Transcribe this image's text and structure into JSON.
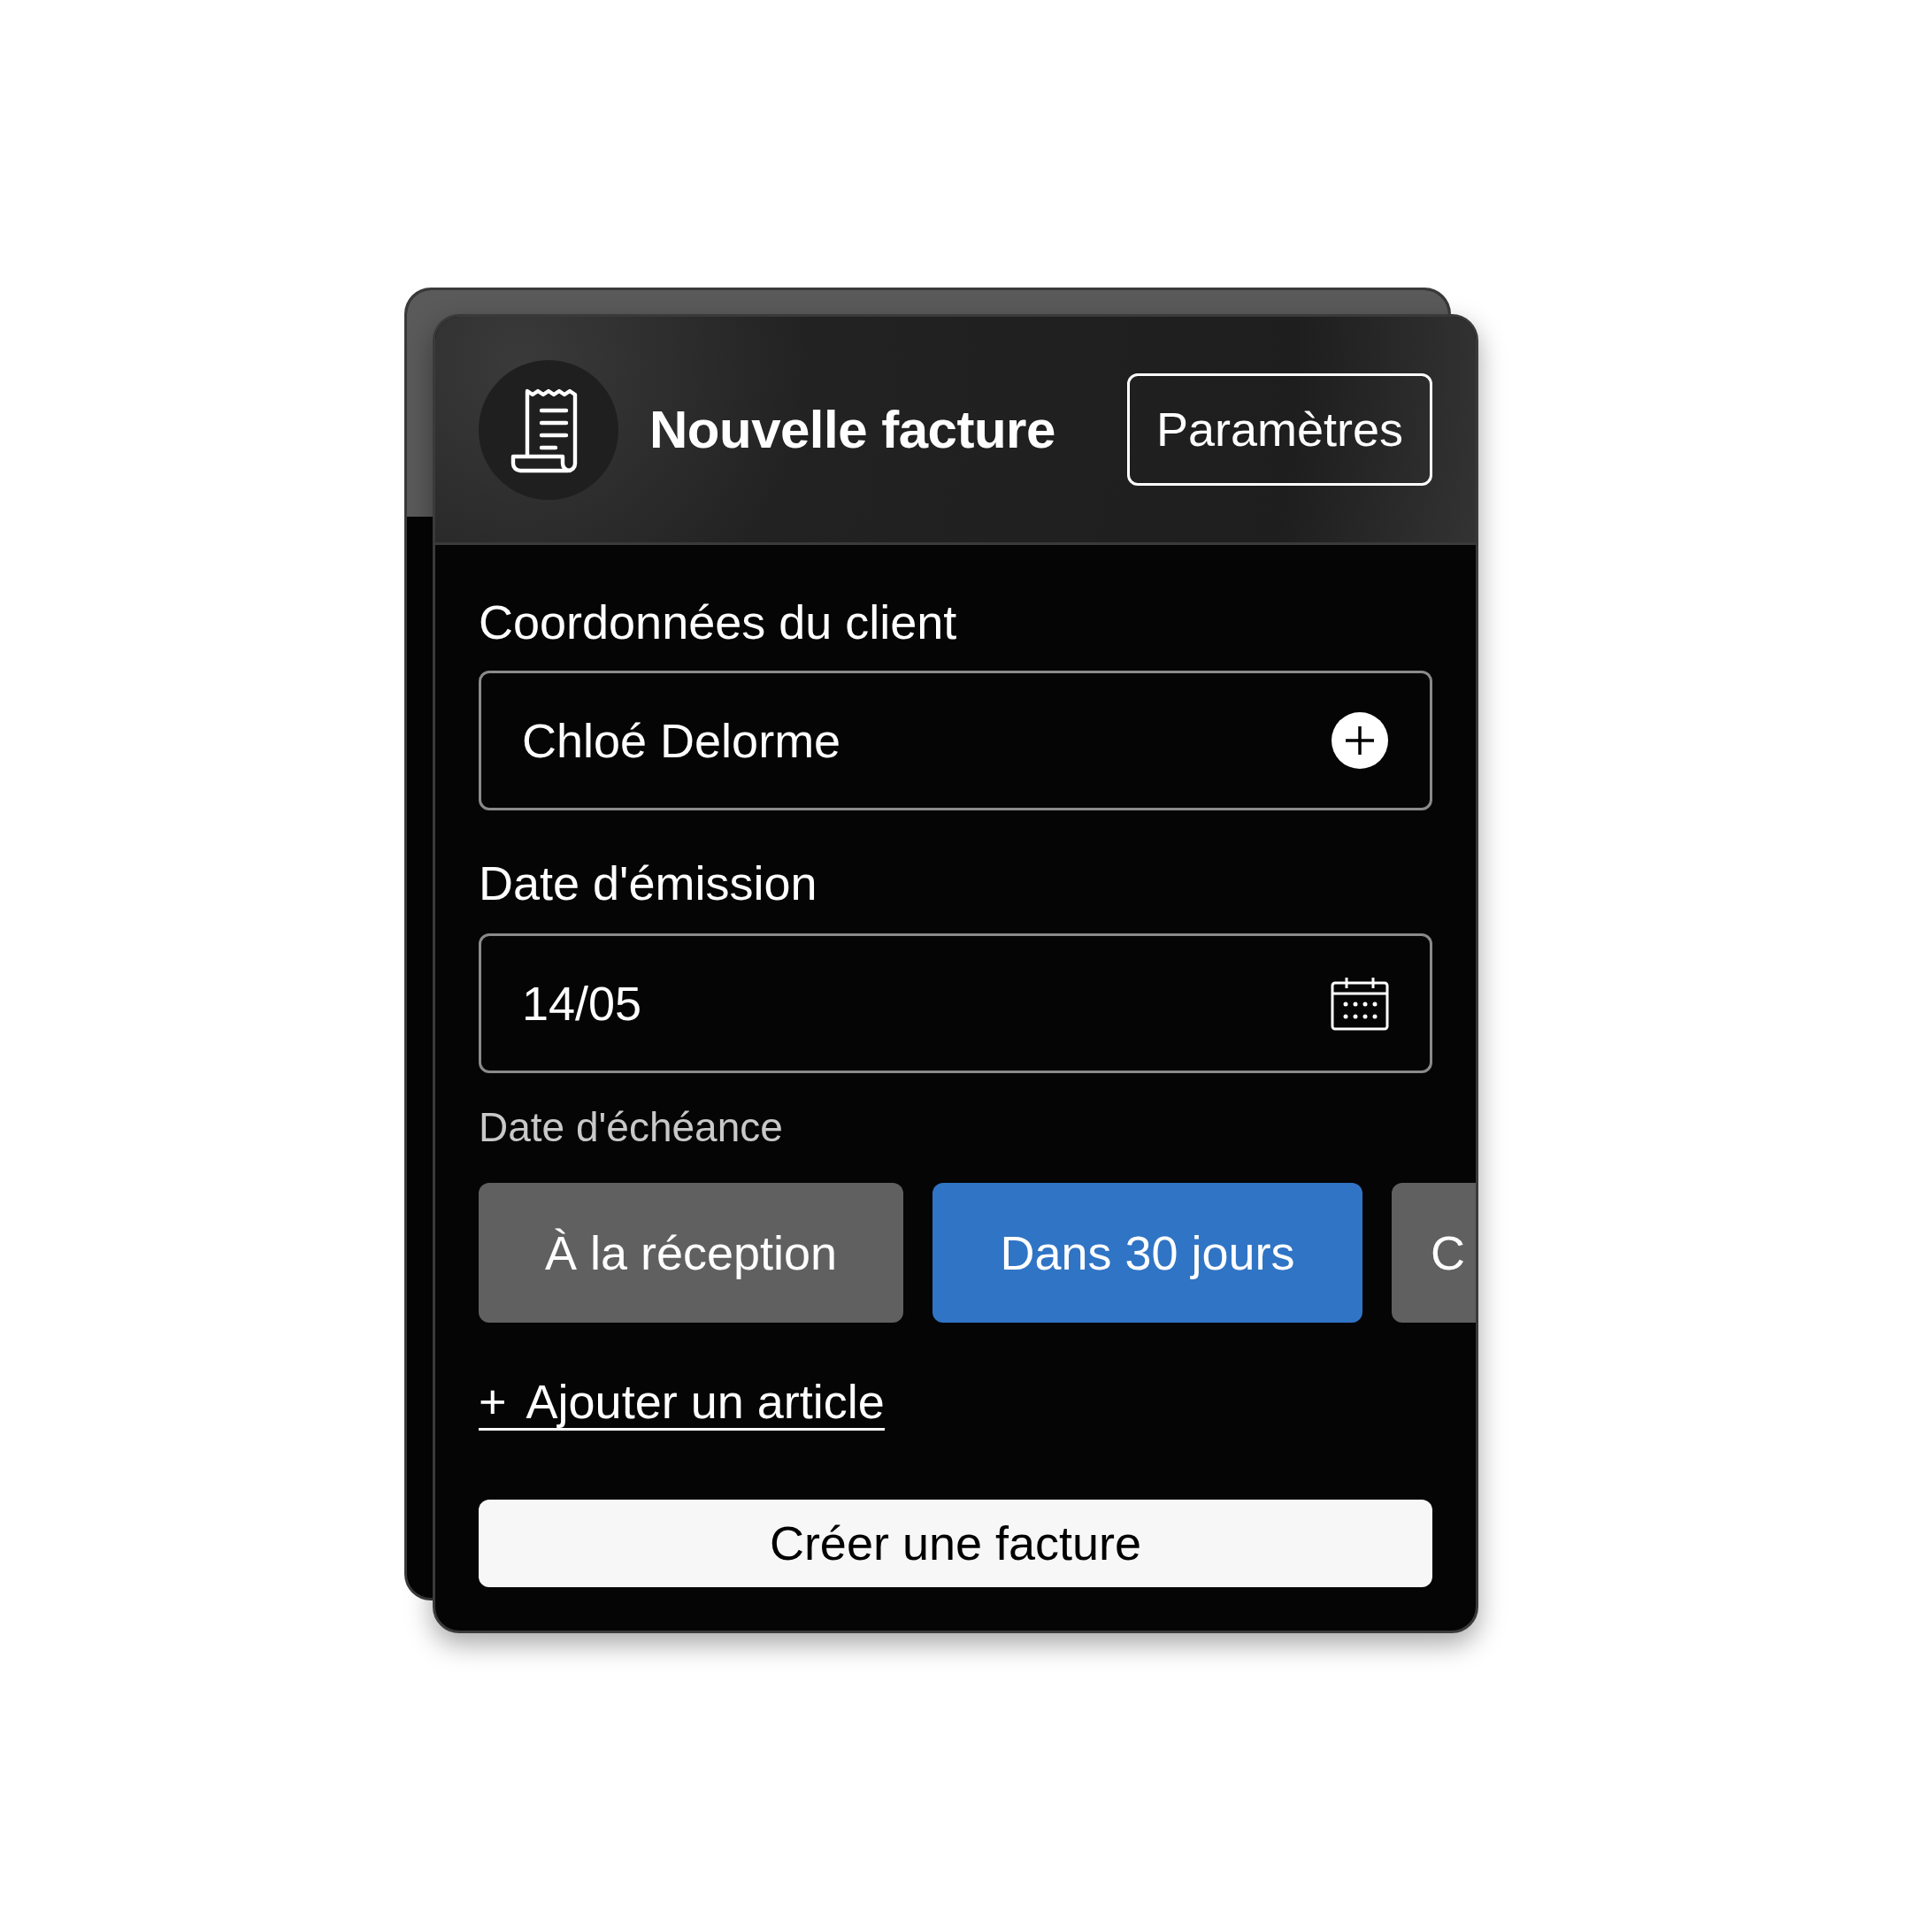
{
  "header": {
    "title": "Nouvelle facture",
    "settings_button": "Paramètres"
  },
  "client": {
    "label": "Coordonnées du client",
    "value": "Chloé Delorme"
  },
  "issue_date": {
    "label": "Date d'émission",
    "value": "14/05"
  },
  "due_date": {
    "label": "Date d'échéance",
    "options": [
      {
        "label": "À la réception",
        "selected": false
      },
      {
        "label": "Dans 30 jours",
        "selected": true
      },
      {
        "label": "C",
        "selected": false
      }
    ]
  },
  "add_item_link": {
    "icon": "+",
    "label": "Ajouter un article"
  },
  "submit_button": "Créer une facture"
}
